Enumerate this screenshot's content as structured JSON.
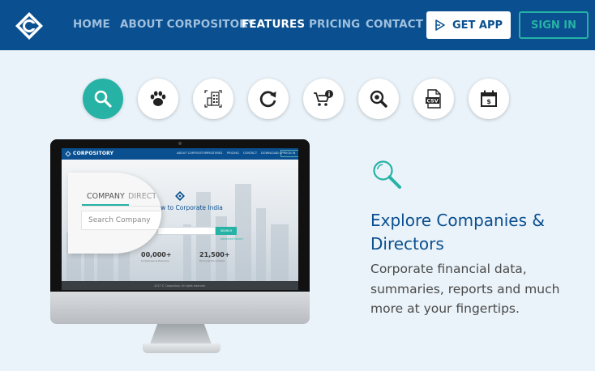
{
  "brand": {
    "logo_icon": "compository-logo-icon",
    "color": "#0a4f8f",
    "accent": "#27b2a6"
  },
  "nav": {
    "links": [
      {
        "label": "HOME",
        "active": false
      },
      {
        "label": "ABOUT CORPOSITORY",
        "active": false
      },
      {
        "label": "FEATURES",
        "active": true
      },
      {
        "label": "PRICING",
        "active": false
      },
      {
        "label": "CONTACT",
        "active": false
      }
    ],
    "get_app_label": "GET APP",
    "sign_in_label": "SIGN IN"
  },
  "features": [
    {
      "icon": "search-icon",
      "active": true
    },
    {
      "icon": "paw-icon",
      "active": false
    },
    {
      "icon": "document-chart-icon",
      "active": false
    },
    {
      "icon": "refresh-icon",
      "active": false
    },
    {
      "icon": "cart-info-icon",
      "active": false
    },
    {
      "icon": "zoom-icon",
      "active": false
    },
    {
      "icon": "csv-file-icon",
      "active": false
    },
    {
      "icon": "calendar-dollar-icon",
      "active": false
    }
  ],
  "preview": {
    "brand": "CORPOSITORY",
    "nav_links": [
      "ABOUT CORPOSITORY",
      "FEATURES",
      "PRICING",
      "CONTACT"
    ],
    "download_label": "DOWNLOAD APP",
    "signin_label": "SIGN IN",
    "tagline": "ndow to Corporate India",
    "search_button": "SEARCH",
    "advanced": "Advanced Search",
    "stats": [
      {
        "value": "00,000+",
        "label": "Companies & Directors"
      },
      {
        "value": "21,500+",
        "label": "Financial Documents"
      }
    ],
    "footer": "2017 © Corpository. All rights reserved.",
    "magnifier": {
      "tab_company": "COMPANY",
      "tab_directors": "DIRECTO",
      "placeholder": "Search Company"
    }
  },
  "feature_detail": {
    "icon": "search-icon",
    "headline": "Explore Companies & Directors",
    "description": "Corporate financial data, summaries, reports and much more at your fingertips."
  }
}
